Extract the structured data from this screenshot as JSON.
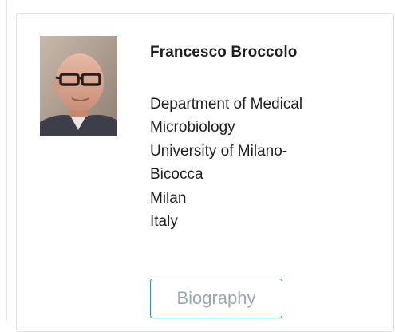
{
  "profile": {
    "name": "Francesco Broccolo",
    "address_lines": [
      "Department of Medical",
      "Microbiology",
      "University of Milano-",
      "Bicocca",
      "Milan",
      "Italy"
    ],
    "biography_button": "Biography"
  }
}
